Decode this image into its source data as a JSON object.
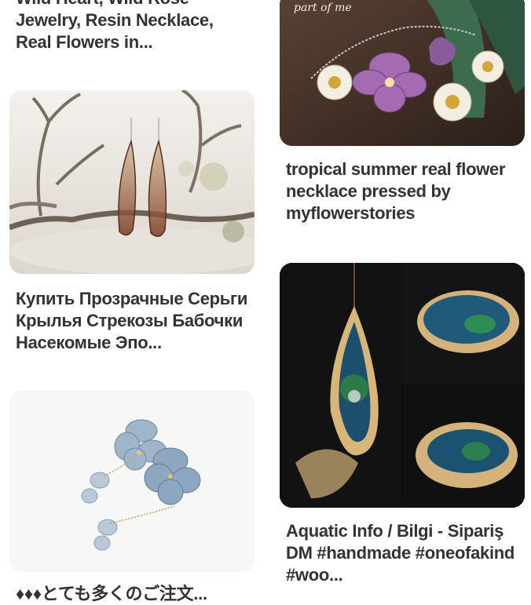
{
  "pins": [
    {
      "title": "Wild Heart, Wild Rose Jewelry, Resin Necklace, Real Flowers in...",
      "image": "resin-necklace-flowers"
    },
    {
      "title": "Купить Прозрачные Серьги Крылья Стрекозы Бабочки Насекомые Эпо...",
      "image": "dragonfly-wing-earrings"
    },
    {
      "title": "♦♦♦とても多くのご注文...",
      "image": "hydrangea-resin-earrings"
    },
    {
      "title": "tropical summer real flower necklace pressed by myflowerstories",
      "image": "pressed-flower-necklace",
      "image_caption": "part of me"
    },
    {
      "title": "Aquatic Info / Bilgi - Sipariş DM #handmade #oneofakind #woo...",
      "image": "wood-resin-pendant"
    }
  ],
  "colors": {
    "title_text": "#333333",
    "background": "#ffffff"
  }
}
